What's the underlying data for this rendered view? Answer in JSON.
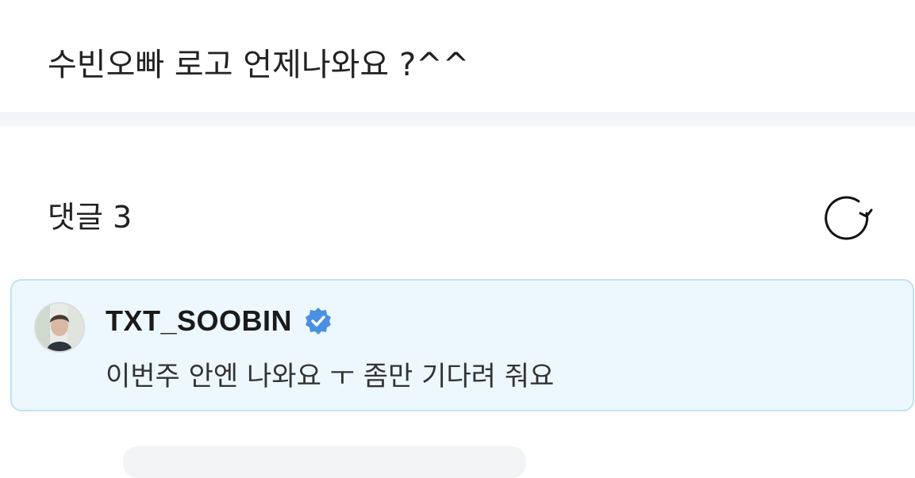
{
  "post": {
    "text": "수빈오빠 로고 언제나와요 ?^^"
  },
  "comments": {
    "header": "댓글 3",
    "refresh_icon": "refresh-icon",
    "items": [
      {
        "author": "TXT_SOOBIN",
        "verified": true,
        "verified_color": "#4a90e2",
        "text": "이번주 안엔 나와요 ㅜ 좀만 기다려 줘요"
      }
    ]
  },
  "colors": {
    "card_background": "#ecf8fd",
    "card_border": "#bfe3f0",
    "divider": "#f3f4f7"
  }
}
